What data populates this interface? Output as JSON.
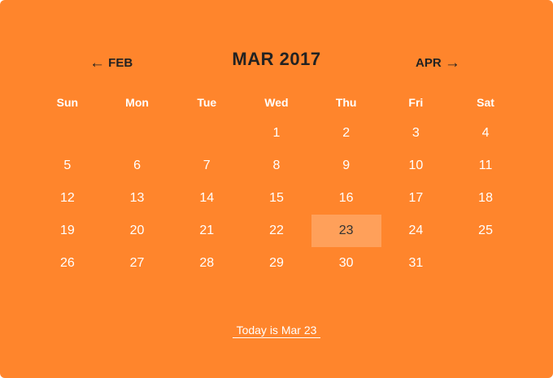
{
  "colors": {
    "background": "#FF852C",
    "today_highlight": "#FFA05A",
    "header_text": "#222222",
    "day_text": "#FFFFFF"
  },
  "header": {
    "prev_arrow": "←",
    "prev_label": "FEB",
    "title": "MAR 2017",
    "next_label": "APR",
    "next_arrow": "→"
  },
  "weekdays": [
    "Sun",
    "Mon",
    "Tue",
    "Wed",
    "Thu",
    "Fri",
    "Sat"
  ],
  "weeks": [
    [
      "",
      "",
      "",
      "1",
      "2",
      "3",
      "4"
    ],
    [
      "5",
      "6",
      "7",
      "8",
      "9",
      "10",
      "11"
    ],
    [
      "12",
      "13",
      "14",
      "15",
      "16",
      "17",
      "18"
    ],
    [
      "19",
      "20",
      "21",
      "22",
      "23",
      "24",
      "25"
    ],
    [
      "26",
      "27",
      "28",
      "29",
      "30",
      "31",
      ""
    ]
  ],
  "selected_day": "23",
  "footer": {
    "today_label": "Today is Mar 23"
  }
}
